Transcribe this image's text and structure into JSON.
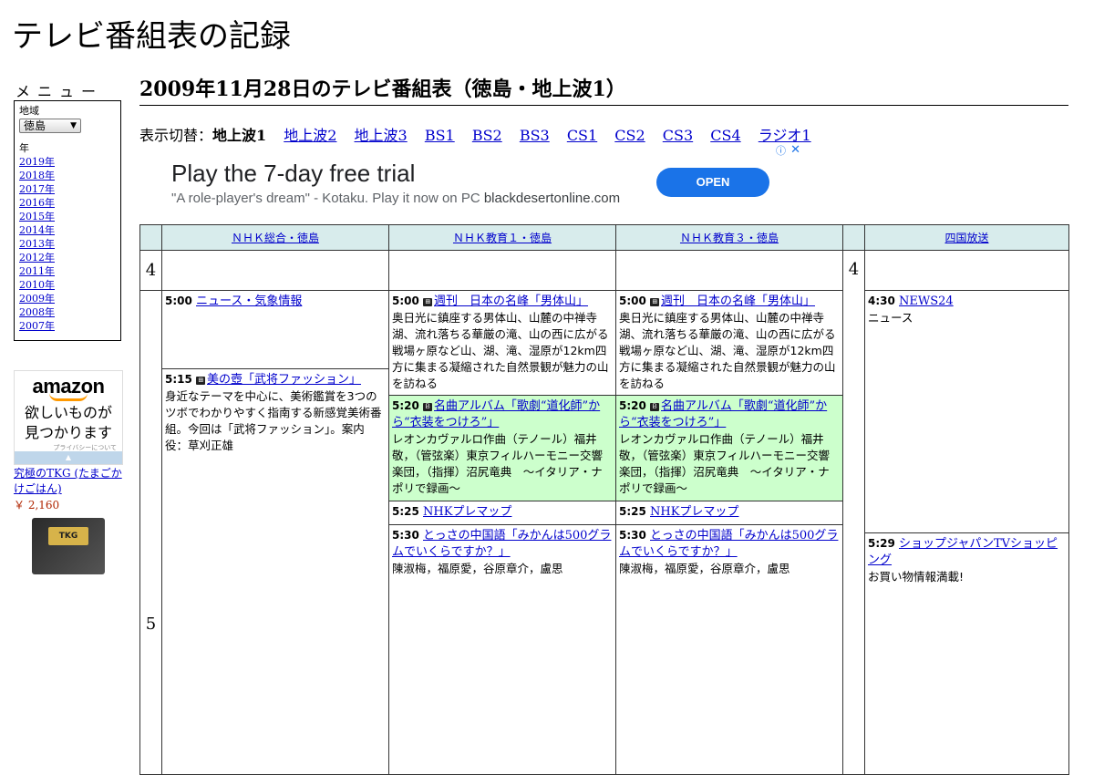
{
  "site_title": "テレビ番組表の記録",
  "sidebar": {
    "menu_heading": "メニュー",
    "region_label": "地域",
    "region_value": "徳島",
    "year_label": "年",
    "years": [
      "2019年",
      "2018年",
      "2017年",
      "2016年",
      "2015年",
      "2014年",
      "2013年",
      "2012年",
      "2011年",
      "2010年",
      "2009年",
      "2008年",
      "2007年"
    ]
  },
  "side_ad": {
    "brand": "amazon",
    "copy_line1": "欲しいものが",
    "copy_line2": "見つかります",
    "privacy": "プライバシーについて",
    "product_title": "究極のTKG (たまごかけごはん)",
    "product_price": "￥ 2,160",
    "product_label": "TKG"
  },
  "page_title": "2009年11月28日のテレビ番組表（徳島・地上波1）",
  "switcher": {
    "label": "表示切替：",
    "current": "地上波1",
    "links": [
      "地上波2",
      "地上波3",
      "BS1",
      "BS2",
      "BS3",
      "CS1",
      "CS2",
      "CS3",
      "CS4",
      "ラジオ1"
    ]
  },
  "banner_ad": {
    "headline": "Play the 7-day free trial",
    "sub": "\"A role-player's dream\" - Kotaku. Play it now on PC",
    "domain": "blackdesertonline.com",
    "cta": "OPEN",
    "info_icon": "info-icon",
    "close_icon": "close-icon"
  },
  "schedule": {
    "channels": [
      "ＮＨＫ総合・徳島",
      "ＮＨＫ教育１・徳島",
      "ＮＨＫ教育３・徳島",
      "四国放送"
    ],
    "hour4": "4",
    "hour5": "5",
    "nhk_sogo": [
      {
        "time": "5:00",
        "title": "ニュース・気象情報",
        "desc": ""
      },
      {
        "time": "5:15",
        "title": "美の壺「武将ファッション」",
        "desc": "身近なテーマを中心に、美術鑑賞を3つのツボでわかりやすく指南する新感覚美術番組。今回は「武将ファッション」。案内役：草刈正雄"
      }
    ],
    "nhk_edu1": [
      {
        "time": "5:00",
        "title": "週刊　日本の名峰「男体山」",
        "desc": "奥日光に鎮座する男体山、山麓の中禅寺湖、流れ落ちる華厳の滝、山の西に広がる戦場ヶ原など山、湖、滝、湿原が12km四方に集まる凝縮された自然景観が魅力の山を訪ねる"
      },
      {
        "time": "5:20",
        "title": "名曲アルバム「歌劇“道化師”から“衣装をつけろ”」",
        "desc": "レオンカヴァルロ作曲（テノール）福井敬，（管弦楽）東京フィルハーモニー交響楽団，（指揮）沼尻竜典　～イタリア・ナポリで録画～"
      },
      {
        "time": "5:25",
        "title": "NHKプレマップ",
        "desc": ""
      },
      {
        "time": "5:30",
        "title": "とっさの中国語「みかんは500グラムでいくらですか？」",
        "desc": "陳淑梅，福原愛，谷原章介，盧思"
      }
    ],
    "nhk_edu3": [
      {
        "time": "5:00",
        "title": "週刊　日本の名峰「男体山」",
        "desc": "奥日光に鎮座する男体山、山麓の中禅寺湖、流れ落ちる華厳の滝、山の西に広がる戦場ヶ原など山、湖、滝、湿原が12km四方に集まる凝縮された自然景観が魅力の山を訪ねる"
      },
      {
        "time": "5:20",
        "title": "名曲アルバム「歌劇“道化師”から“衣装をつけろ”」",
        "desc": "レオンカヴァルロ作曲（テノール）福井敬，（管弦楽）東京フィルハーモニー交響楽団，（指揮）沼尻竜典　～イタリア・ナポリで録画～"
      },
      {
        "time": "5:25",
        "title": "NHKプレマップ",
        "desc": ""
      },
      {
        "time": "5:30",
        "title": "とっさの中国語「みかんは500グラムでいくらですか？」",
        "desc": "陳淑梅，福原愛，谷原章介，盧思"
      }
    ],
    "shikoku": [
      {
        "time": "4:30",
        "title": "NEWS24",
        "desc": "ニュース"
      },
      {
        "time": "5:29",
        "title": "ショップジャパンTVショッピング",
        "desc": "お買い物情報満載!"
      }
    ]
  }
}
